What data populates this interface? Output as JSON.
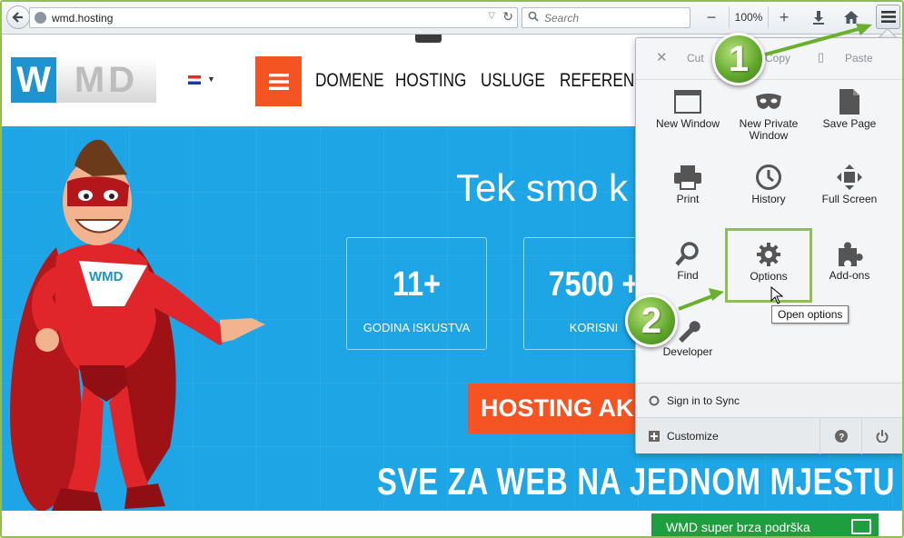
{
  "browser": {
    "url": "wmd.hosting",
    "search_placeholder": "Search",
    "zoom_level": "100%",
    "zoom_minus": "−",
    "zoom_plus": "+"
  },
  "site": {
    "logo_w": "W",
    "logo_md": "MD",
    "nav": [
      "DOMENE",
      "HOSTING",
      "USLUGE",
      "REFERENCE"
    ],
    "hero_title": "Tek smo k",
    "stats": [
      {
        "value": "11+",
        "label": "GODINA ISKUSTVA"
      },
      {
        "value": "7500 +",
        "label": "KORISNI"
      }
    ],
    "hosting_button": "HOSTING AK",
    "slogan": "SVE ZA WEB NA JEDNOM MJESTU",
    "support_button": "WMD super brza podrška",
    "mascot_chest_text": "WMD"
  },
  "menu_panel": {
    "edit": {
      "cut": "Cut",
      "copy": "Copy",
      "paste": "Paste"
    },
    "items": [
      {
        "label": "New Window",
        "icon": "new-window-icon"
      },
      {
        "label": "New Private Window",
        "icon": "private-mask-icon"
      },
      {
        "label": "Save Page",
        "icon": "save-page-icon"
      },
      {
        "label": "Print",
        "icon": "print-icon"
      },
      {
        "label": "History",
        "icon": "history-clock-icon"
      },
      {
        "label": "Full Screen",
        "icon": "full-screen-icon"
      },
      {
        "label": "Find",
        "icon": "find-magnifier-icon"
      },
      {
        "label": "Options",
        "icon": "options-gear-icon"
      },
      {
        "label": "Add-ons",
        "icon": "addons-puzzle-icon"
      },
      {
        "label": "Developer",
        "icon": "developer-wrench-icon"
      }
    ],
    "sync": "Sign in to Sync",
    "customize": "Customize",
    "tooltip": "Open options"
  },
  "annotations": {
    "step1": "1",
    "step2": "2",
    "arrow_color": "#6ab02e"
  }
}
